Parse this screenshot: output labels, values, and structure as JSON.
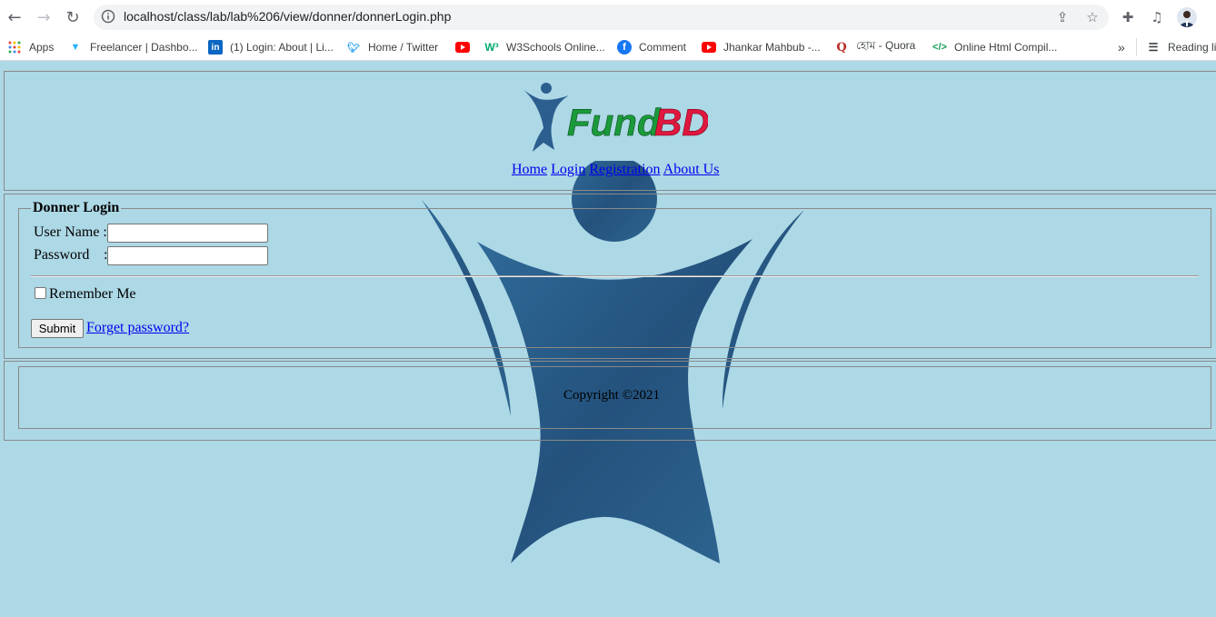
{
  "browser": {
    "url": "localhost/class/lab/lab%206/view/donner/donnerLogin.php",
    "bookmarks": [
      {
        "label": "Apps",
        "icon": "apps-grid-icon"
      },
      {
        "label": "Freelancer | Dashbo...",
        "icon": "freelancer-icon"
      },
      {
        "label": "(1) Login: About | Li...",
        "icon": "linkedin-icon"
      },
      {
        "label": "Home / Twitter",
        "icon": "twitter-icon"
      },
      {
        "label": "",
        "icon": "youtube-icon"
      },
      {
        "label": "W3Schools Online...",
        "icon": "w3schools-icon"
      },
      {
        "label": "Comment",
        "icon": "facebook-icon"
      },
      {
        "label": "Jhankar Mahbub -...",
        "icon": "youtube-icon"
      },
      {
        "label": "হোম - Quora",
        "icon": "quora-icon"
      },
      {
        "label": "Online Html Compil...",
        "icon": "code-icon"
      }
    ],
    "overflow_label": "»",
    "reading_list_label": "Reading lis"
  },
  "header": {
    "logo_text": "FundBD",
    "nav": {
      "home": "Home",
      "login": "Login",
      "registration": "Registration",
      "about": "About Us"
    }
  },
  "login": {
    "legend": "Donner Login",
    "username_label": "User Name :",
    "password_label": "Password",
    "password_colon": ":",
    "username_value": "",
    "password_value": "",
    "remember_label": "Remember Me",
    "remember_checked": false,
    "submit_label": "Submit",
    "forgot_label": "Forget password?"
  },
  "footer": {
    "copyright": "Copyright ©2021"
  },
  "colors": {
    "page_background": "#add8e6",
    "logo_green": "#1a9a3a",
    "logo_red": "#e0173f",
    "watermark_blue": "#2c5f8f"
  }
}
